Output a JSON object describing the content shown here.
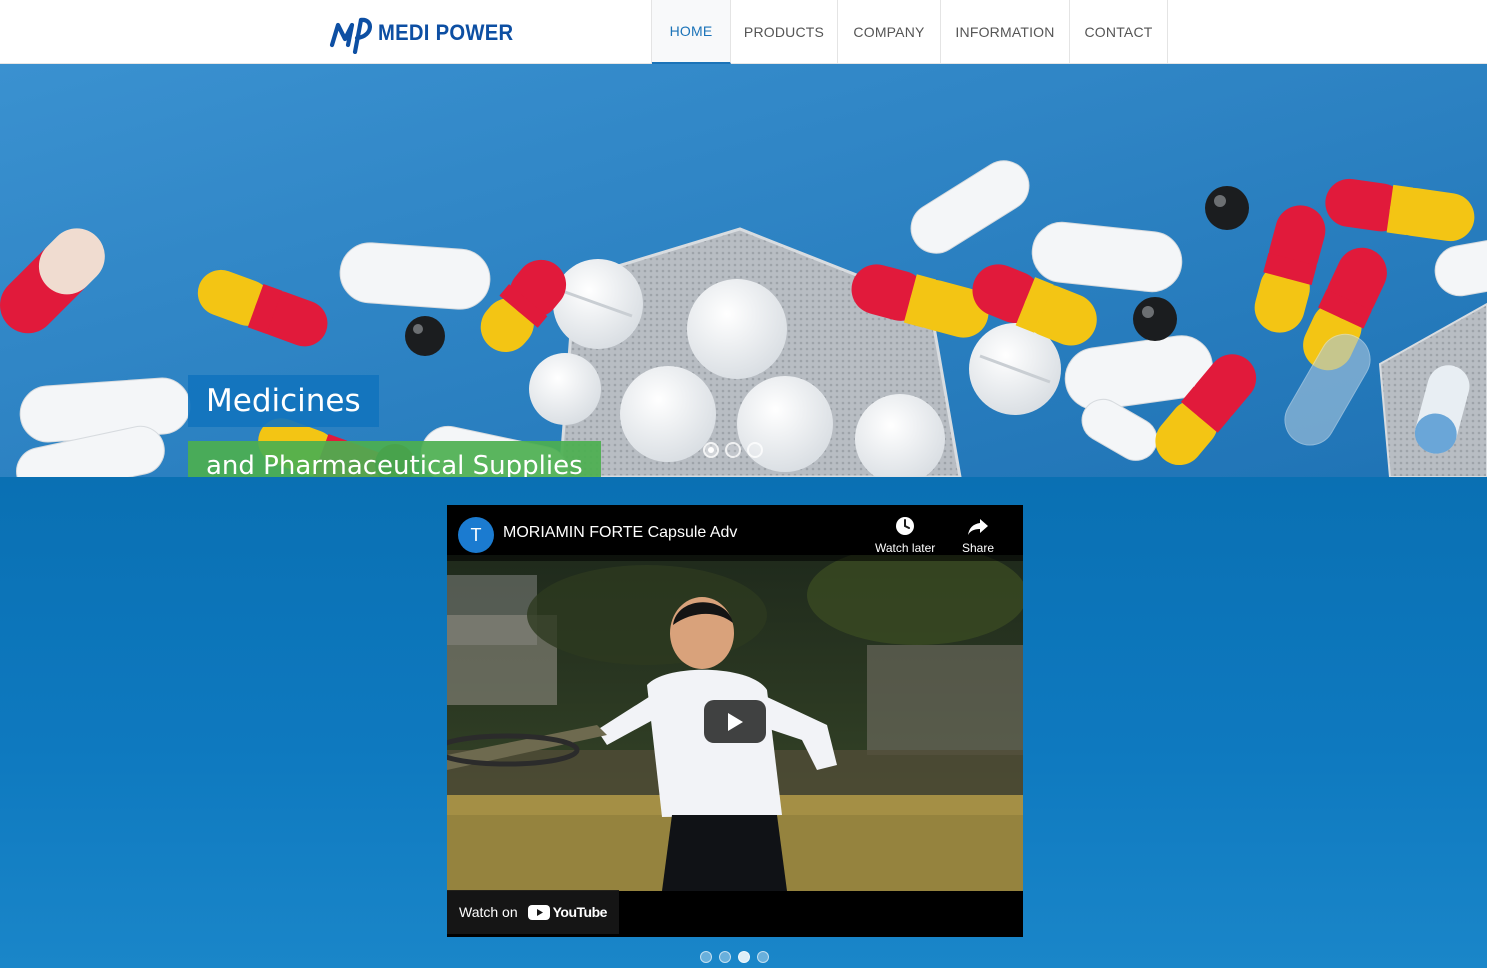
{
  "brand": {
    "name": "MEDI POWER",
    "logo_initials": "MP",
    "color": "#0d4fa3"
  },
  "nav": {
    "items": [
      {
        "label": "HOME",
        "active": true
      },
      {
        "label": "PRODUCTS",
        "active": false
      },
      {
        "label": "COMPANY",
        "active": false
      },
      {
        "label": "INFORMATION",
        "active": false
      },
      {
        "label": "CONTACT",
        "active": false
      }
    ]
  },
  "hero": {
    "caption_primary": "Medicines",
    "caption_secondary": "and Pharmaceutical Supplies",
    "slide_count": 3,
    "active_slide": 1,
    "colors": {
      "background": "#2f86c6",
      "caption_primary_bg": "#1274be",
      "caption_secondary_bg": "#4caf50"
    }
  },
  "video": {
    "channel_initial": "T",
    "title": "MORIAMIN FORTE Capsule Adv",
    "watch_later_label": "Watch later",
    "share_label": "Share",
    "watch_on_label": "Watch on",
    "platform_label": "YouTube",
    "carousel_count": 4,
    "carousel_active": 3
  }
}
